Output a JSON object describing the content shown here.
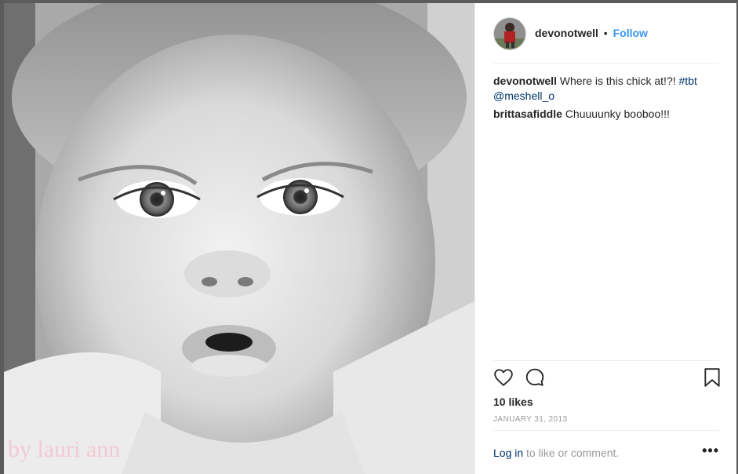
{
  "post": {
    "username": "devonotwell",
    "separator": "•",
    "follow_label": "Follow",
    "photo_watermark": "by lauri ann"
  },
  "comments": [
    {
      "user": "devonotwell",
      "text": "Where is this chick at!?!",
      "hashtag": "#tbt",
      "mention": "@meshell_o"
    },
    {
      "user": "brittasafiddle",
      "text": "Chuuuunky booboo!!!"
    }
  ],
  "stats": {
    "likes": "10 likes",
    "date": "JANUARY 31, 2013"
  },
  "footer": {
    "login_link": "Log in",
    "login_text": "to like or comment.",
    "more": "•••"
  },
  "icons": {
    "like": "heart-icon",
    "comment": "comment-bubble-icon",
    "save": "bookmark-icon",
    "more": "more-options-icon"
  },
  "colors": {
    "accent": "#3897f0",
    "link": "#003569",
    "muted": "#999999"
  }
}
